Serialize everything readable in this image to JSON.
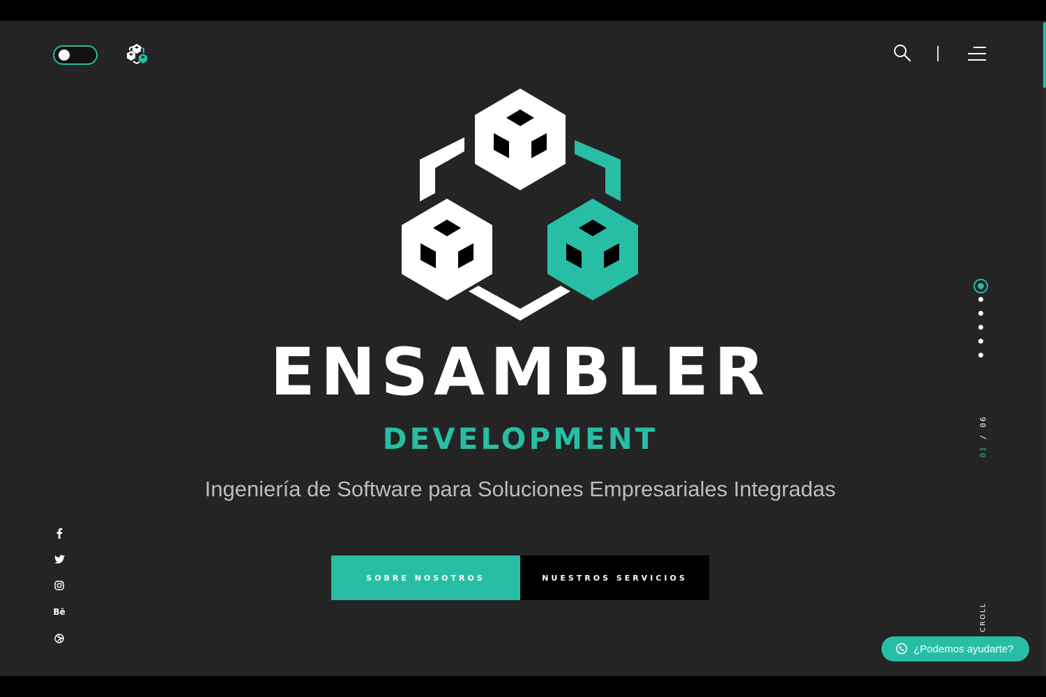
{
  "header": {
    "theme_toggle": "dark-mode-toggle",
    "logo_icon": "ensambler-logo-icon",
    "search_icon": "search-icon",
    "menu_icon": "hamburger-menu-icon"
  },
  "hero": {
    "title": "ENSAMBLER",
    "brand_subtitle": "DEVELOPMENT",
    "tagline": "Ingeniería de Software para Soluciones Empresariales Integradas",
    "buttons": {
      "primary": "SOBRE NOSOTROS",
      "secondary": "NUESTROS SERVICIOS"
    }
  },
  "social": [
    {
      "name": "facebook",
      "icon": "facebook-icon"
    },
    {
      "name": "twitter",
      "icon": "twitter-icon"
    },
    {
      "name": "instagram",
      "icon": "instagram-icon"
    },
    {
      "name": "behance",
      "icon": "behance-icon",
      "text": "Bē"
    },
    {
      "name": "dribbble",
      "icon": "dribbble-icon"
    }
  ],
  "pagination": {
    "current": "01",
    "separator": "/",
    "total": "06",
    "dot_count": 6,
    "active_index": 0
  },
  "scroll_label": "CROLL",
  "chat": {
    "label": "¿Podemos ayudarte?",
    "icon": "whatsapp-icon"
  },
  "colors": {
    "accent": "#27bea5",
    "background": "#242424",
    "text": "#ffffff",
    "tagline": "#bdbdbd"
  }
}
